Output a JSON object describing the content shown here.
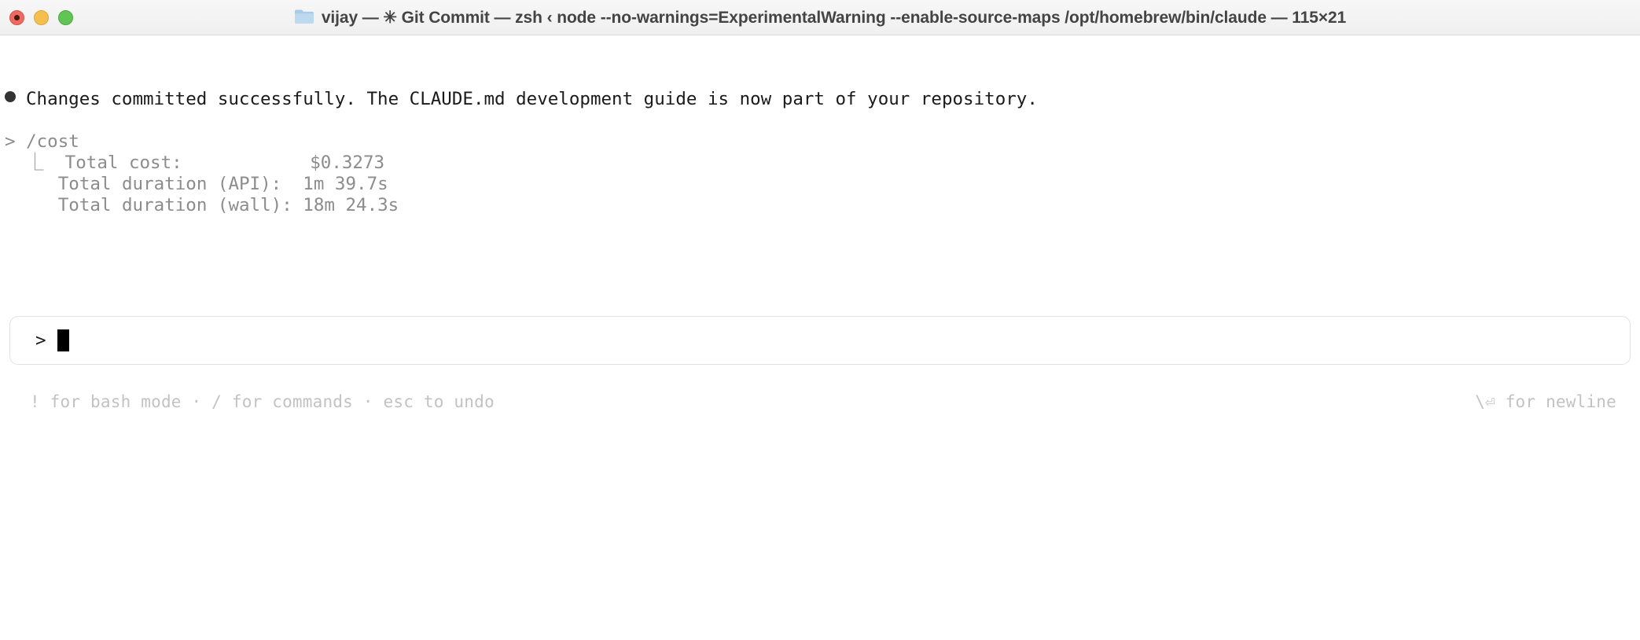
{
  "titlebar": {
    "folder_icon": "folder-icon",
    "title": "vijay — ✳ Git Commit — zsh ‹ node --no-warnings=ExperimentalWarning --enable-source-maps /opt/homebrew/bin/claude — 115×21",
    "controls": {
      "close_label": "close",
      "minimize_label": "minimize",
      "maximize_label": "maximize"
    }
  },
  "terminal": {
    "assistant_message": {
      "bullet": "●",
      "text": "Changes committed successfully. The CLAUDE.md development guide is now part of your repository."
    },
    "cost_command": {
      "prompt": "> ",
      "command": "/cost",
      "results": [
        "  ⎿  Total cost:            $0.3273",
        "     Total duration (API):  1m 39.7s",
        "     Total duration (wall): 18m 24.3s"
      ]
    },
    "input": {
      "prompt": ">",
      "value": "",
      "placeholder": ""
    },
    "hints": {
      "left": "! for bash mode · / for commands · esc to undo",
      "right": "\\⏎ for newline"
    }
  },
  "colors": {
    "titlebar_bg": "#f2f2f2",
    "terminal_bg": "#ffffff",
    "text": "#1a1a1a",
    "muted": "#8c8c8c",
    "hint": "#c2c2c2",
    "close": "#ec6a5f",
    "minimize": "#f4bf4f",
    "maximize": "#61c554",
    "input_border": "#e2e2e2"
  }
}
